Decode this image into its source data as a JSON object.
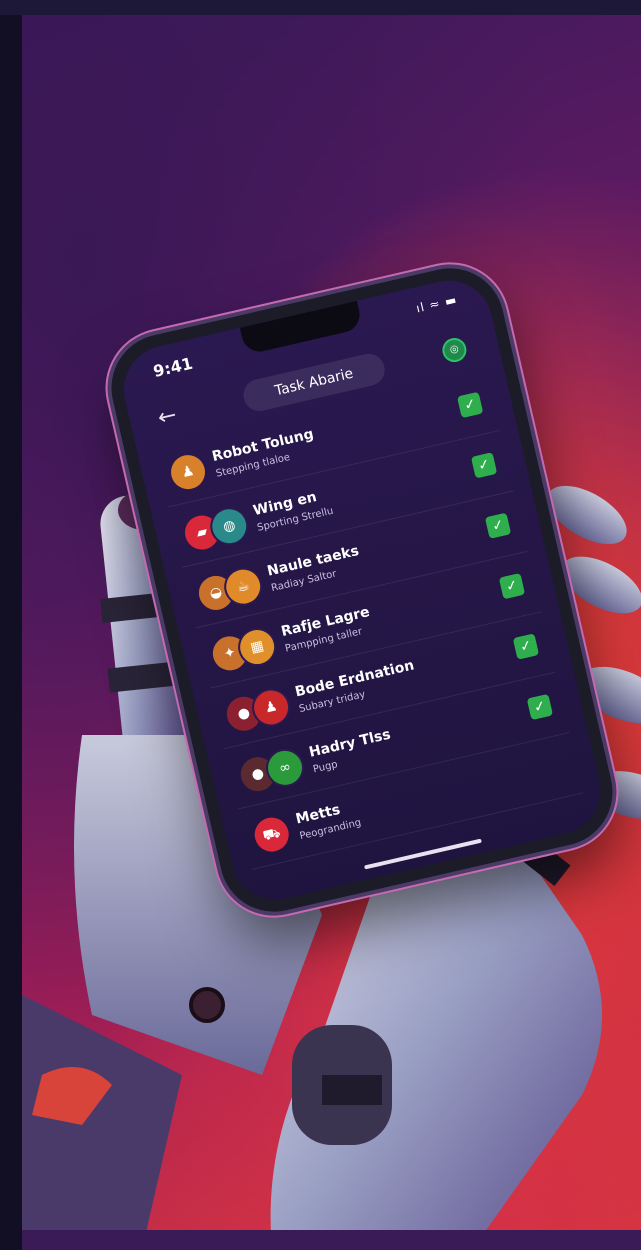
{
  "colors": {
    "accent_check": "#2fae4e",
    "screen_bg": "#2a1850",
    "title_pill": "#3b2c5e"
  },
  "phone": {
    "status_time": "9:41",
    "status_icons": "ıl ≈ ▬",
    "back_icon": "arrow-left-icon",
    "header_title": "Task Abarie",
    "header_icon": "settings-icon"
  },
  "tasks": [
    {
      "name": "Robot Tolung",
      "sub": "Stepping tlaloe",
      "avatar_icons": [
        "person-icon"
      ],
      "avatar_colors": [
        "#d9802a"
      ],
      "checked": true
    },
    {
      "name": "Wing en",
      "sub": "Sporting Strellu",
      "avatar_icons": [
        "car-icon",
        "globe-icon"
      ],
      "avatar_colors": [
        "#d8283a",
        "#2a8a8a"
      ],
      "checked": true
    },
    {
      "name": "Naule taeks",
      "sub": "Radiay Saltor",
      "avatar_icons": [
        "bowl-icon",
        "cup-icon"
      ],
      "avatar_colors": [
        "#c9702a",
        "#e08a2a"
      ],
      "checked": true
    },
    {
      "name": "Rafje Lagre",
      "sub": "Pampping taller",
      "avatar_icons": [
        "tool-icon",
        "calendar-icon"
      ],
      "avatar_colors": [
        "#c9702a",
        "#e0902a"
      ],
      "checked": true
    },
    {
      "name": "Bode Erdnation",
      "sub": "Subary triday",
      "avatar_icons": [
        "circle-icon",
        "person-icon"
      ],
      "avatar_colors": [
        "#8a2030",
        "#c8282a"
      ],
      "checked": true
    },
    {
      "name": "Hadry Tlss",
      "sub": "Pugp",
      "avatar_icons": [
        "circle-icon",
        "link-icon"
      ],
      "avatar_colors": [
        "#5a2a30",
        "#2a9a3a"
      ],
      "checked": true
    },
    {
      "name": "Metts",
      "sub": "Peogranding",
      "avatar_icons": [
        "cart-icon"
      ],
      "avatar_colors": [
        "#d8283a"
      ],
      "checked": false
    }
  ]
}
